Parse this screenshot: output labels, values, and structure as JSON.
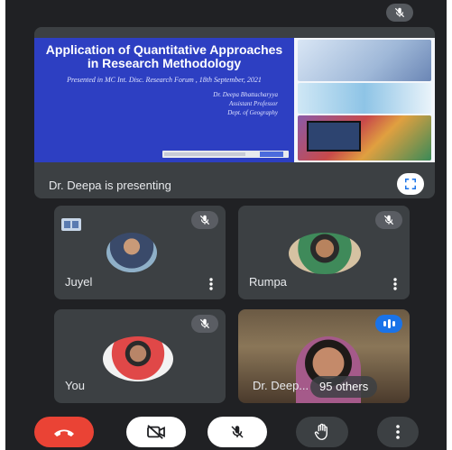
{
  "presentation": {
    "slide_title": "Application of Quantitative Approaches in Research Methodology",
    "slide_subtitle": "Presented in MC Int. Disc. Research Forum , 18th September, 2021",
    "slide_author_lines": [
      "Dr. Deepa Bhattacharyya",
      "Assistant Professor",
      "Dept. of Geography"
    ],
    "label": "Dr. Deepa is presenting"
  },
  "participants": [
    {
      "name": "Juyel",
      "muted": true
    },
    {
      "name": "Rumpa",
      "muted": true
    },
    {
      "name": "You",
      "muted": true
    },
    {
      "name": "Dr. Deep...",
      "overlay": "95 others",
      "speaking": true
    }
  ],
  "colors": {
    "background": "#202124",
    "tile": "#3c4043",
    "slide_blue": "#2d3fc2",
    "end_call": "#ea4335",
    "speaking": "#1a73e8"
  },
  "icons": {
    "end_call": "phone-hangup-icon",
    "camera": "camera-off-icon",
    "mic": "mic-off-icon",
    "hand": "raise-hand-icon",
    "more": "more-vert-icon",
    "fullscreen": "fullscreen-icon"
  }
}
